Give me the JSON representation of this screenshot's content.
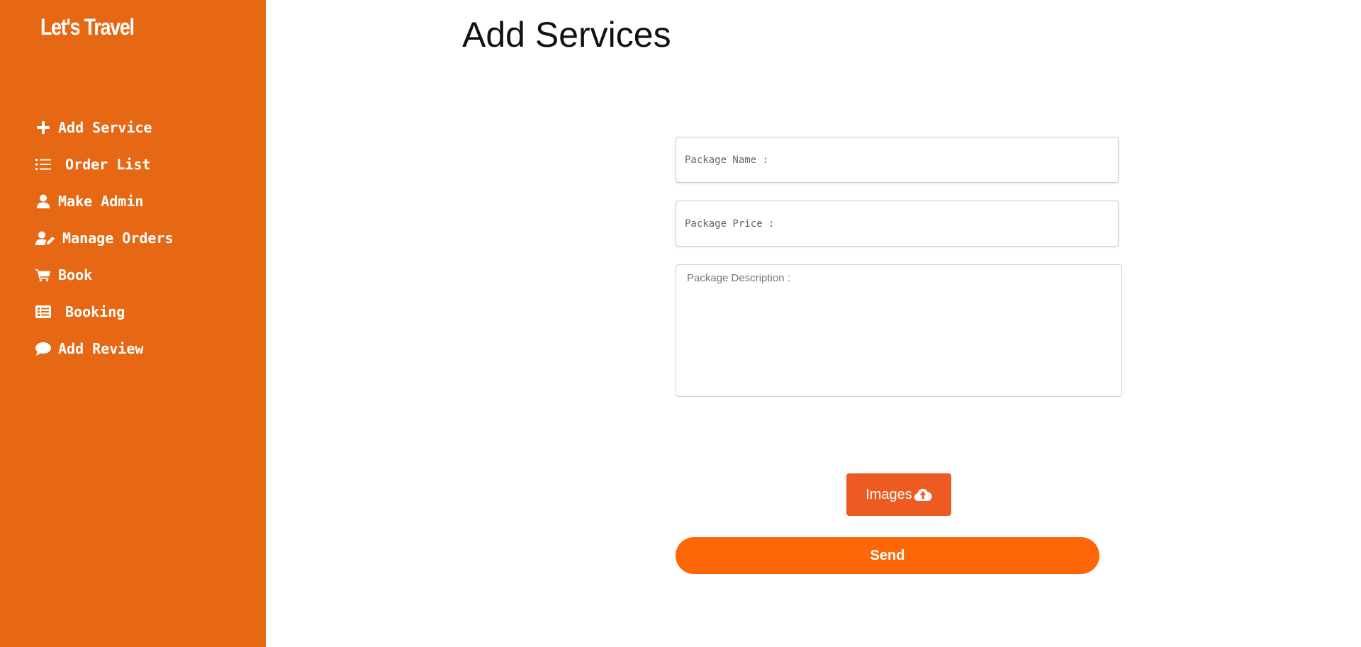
{
  "sidebar": {
    "brand": "Let's Travel",
    "background_color": "#e66714",
    "items": [
      {
        "label": "Add Service",
        "icon": "plus-icon"
      },
      {
        "label": "Order List",
        "icon": "list-icon"
      },
      {
        "label": "Make Admin",
        "icon": "user-icon"
      },
      {
        "label": "Manage Orders",
        "icon": "user-edit-icon"
      },
      {
        "label": "Book",
        "icon": "cart-icon"
      },
      {
        "label": "Booking",
        "icon": "list-alt-icon"
      },
      {
        "label": "Add Review",
        "icon": "comment-icon"
      }
    ]
  },
  "main": {
    "title": "Add Services",
    "form": {
      "name_placeholder": "Package Name :",
      "name_value": "",
      "price_placeholder": "Package Price :",
      "price_value": "",
      "description_placeholder": "Package Description :",
      "description_value": "",
      "images_label": "Images",
      "images_icon": "cloud-upload-icon",
      "send_label": "Send"
    },
    "colors": {
      "images_button": "#ee5b22",
      "send_button": "#ff6608"
    }
  }
}
